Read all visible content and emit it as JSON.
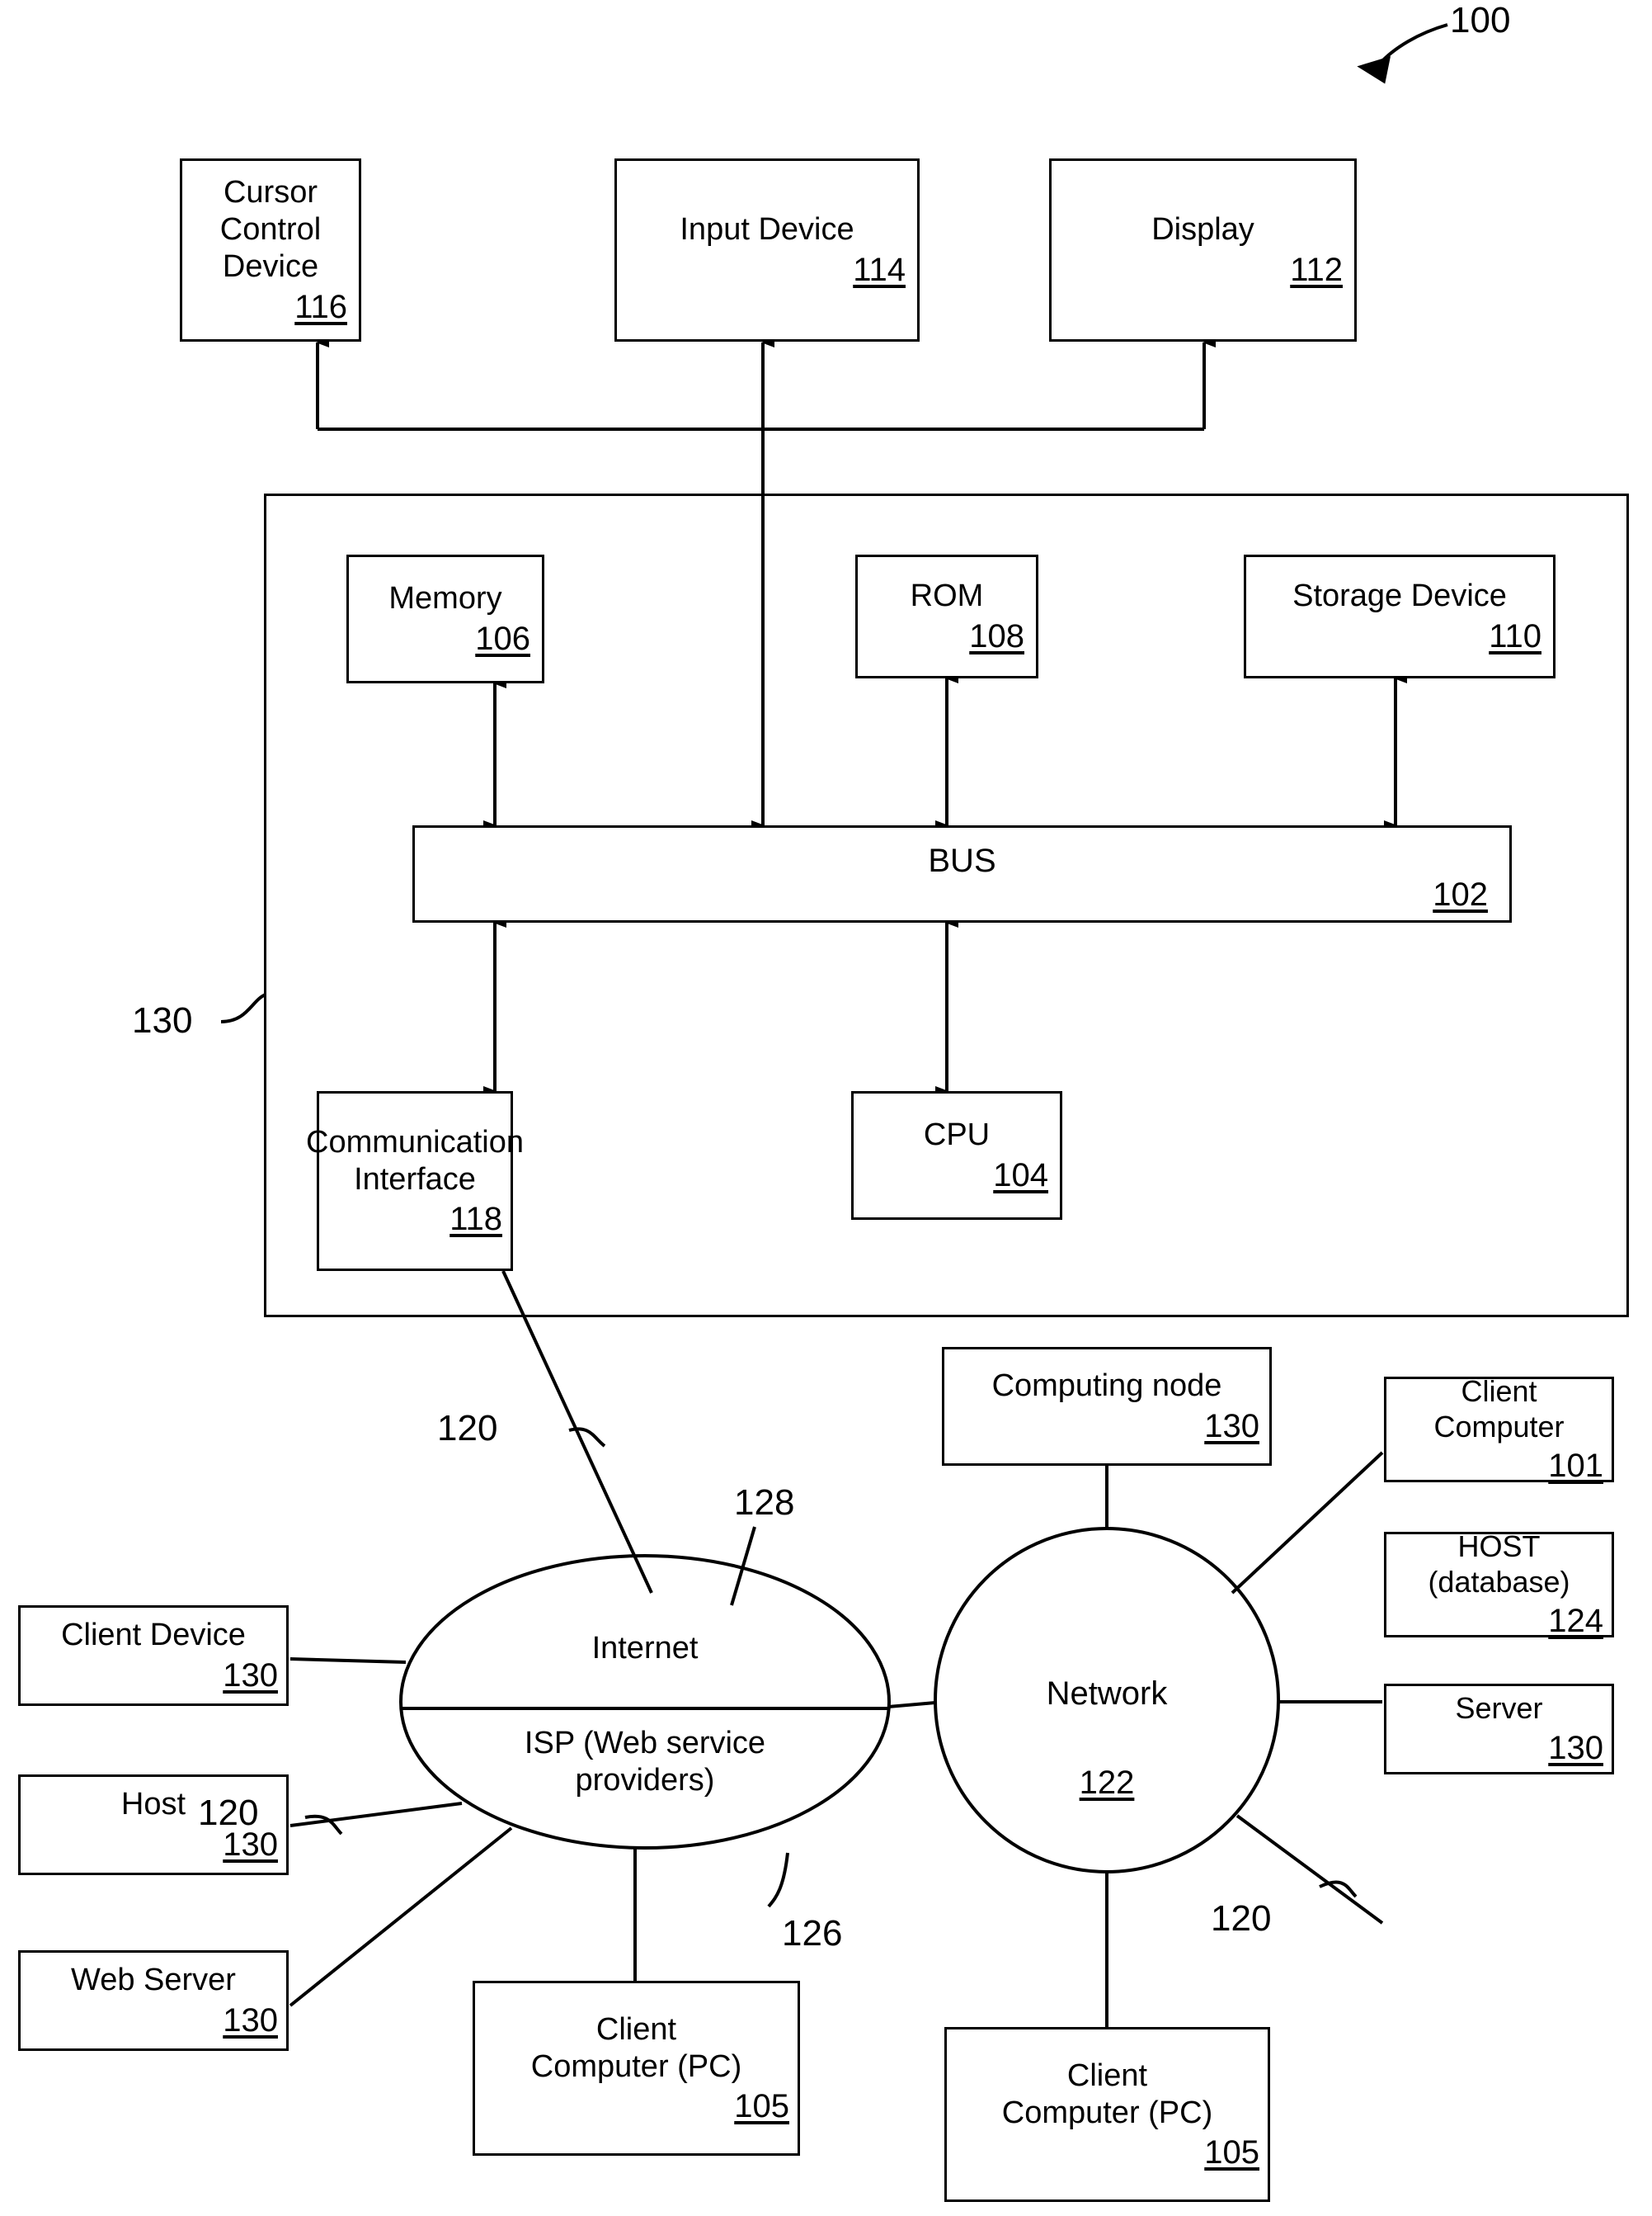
{
  "figure": {
    "reference_numeral": "100"
  },
  "blocks": {
    "cursor_control": {
      "label": "Cursor Control\nDevice",
      "num": "116"
    },
    "input_device": {
      "label": "Input Device",
      "num": "114"
    },
    "display": {
      "label": "Display",
      "num": "112"
    },
    "memory": {
      "label": "Memory",
      "num": "106"
    },
    "rom": {
      "label": "ROM",
      "num": "108"
    },
    "storage_device": {
      "label": "Storage Device",
      "num": "110"
    },
    "bus": {
      "label": "BUS",
      "num": "102"
    },
    "comm_interface": {
      "label": "Communication\nInterface",
      "num": "118"
    },
    "cpu": {
      "label": "CPU",
      "num": "104"
    },
    "computing_node": {
      "label": "Computing node",
      "num": "130"
    },
    "client_computer_101": {
      "label": "Client\nComputer",
      "num": "101"
    },
    "host_database": {
      "label": "HOST\n(database)",
      "num": "124"
    },
    "server": {
      "label": "Server",
      "num": "130"
    },
    "client_device": {
      "label": "Client Device",
      "num": "130"
    },
    "host": {
      "label": "Host",
      "num": "130"
    },
    "web_server": {
      "label": "Web Server",
      "num": "130"
    },
    "client_pc_left": {
      "label": "Client\nComputer (PC)",
      "num": "105"
    },
    "client_pc_bottom": {
      "label": "Client\nComputer (PC)",
      "num": "105"
    }
  },
  "clouds": {
    "internet": {
      "top_label": "Internet",
      "bottom_label": "ISP (Web service\nproviders)"
    },
    "network": {
      "label": "Network",
      "num": "122"
    }
  },
  "callouts": {
    "outer_frame_ref": "130",
    "comm_link_ref": "120",
    "internet_ref": "128",
    "isp_ref": "126",
    "left_link_ref": "120",
    "server_link_ref": "120"
  }
}
